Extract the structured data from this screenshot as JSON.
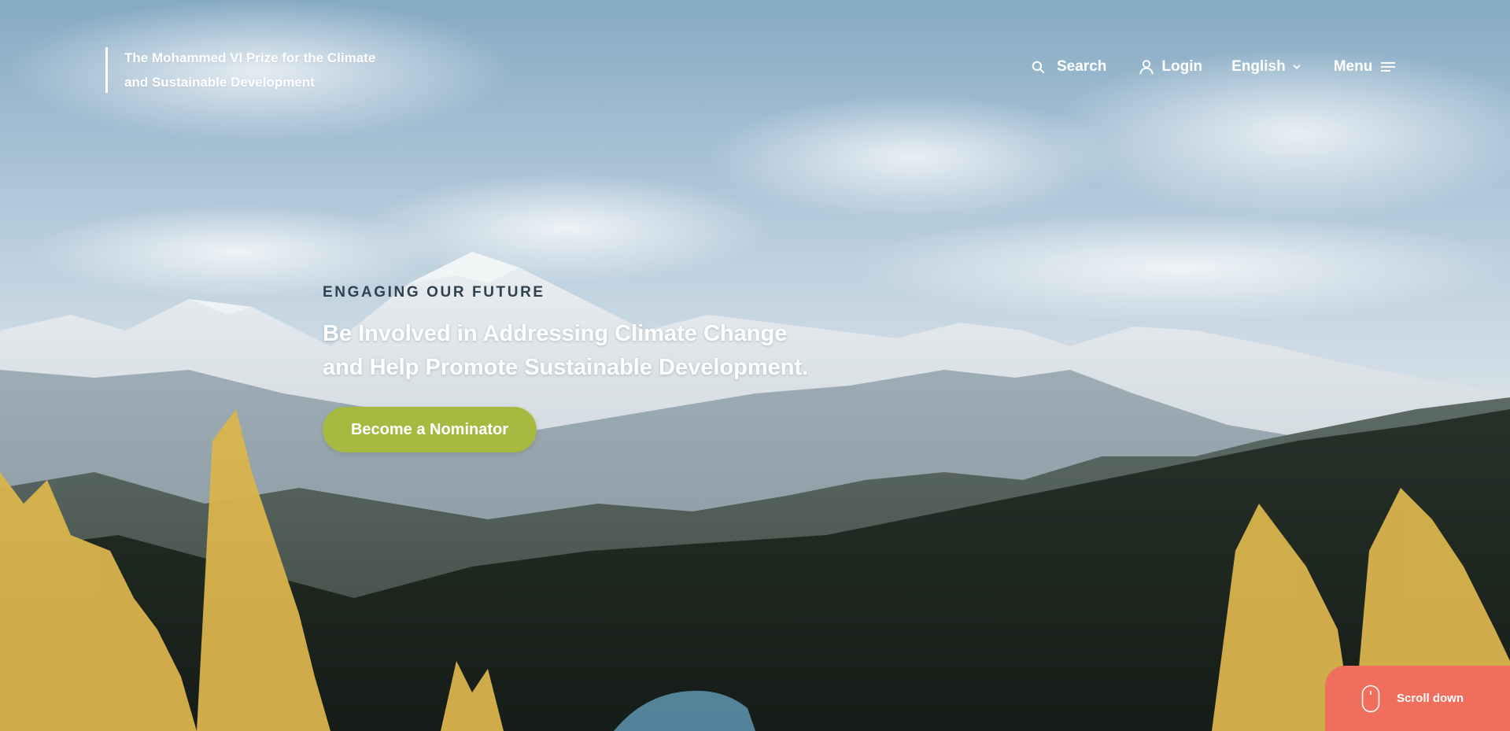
{
  "brand": {
    "line1": "The Mohammed VI Prize for the Climate",
    "line2": "and Sustainable Development"
  },
  "nav": {
    "search_label": "Search",
    "search_icon": "search-icon",
    "login_label": "Login",
    "login_icon": "user-icon",
    "language_label": "English",
    "language_icon": "chevron-down-icon",
    "menu_label": "Menu",
    "menu_icon": "hamburger-menu-icon"
  },
  "hero": {
    "eyebrow": "ENGAGING OUR FUTURE",
    "headline_line1": "Be Involved in Addressing Climate Change",
    "headline_line2": "and Help Promote Sustainable Development.",
    "cta_label": "Become a Nominator",
    "background": "mountain-forest-landscape"
  },
  "scroll": {
    "label": "Scroll down",
    "icon": "mouse-icon"
  },
  "colors": {
    "cta_green": "#a8b942",
    "scroll_coral": "#f06e5c",
    "eyebrow_slate": "#2e4250",
    "text_white": "#ffffff"
  }
}
